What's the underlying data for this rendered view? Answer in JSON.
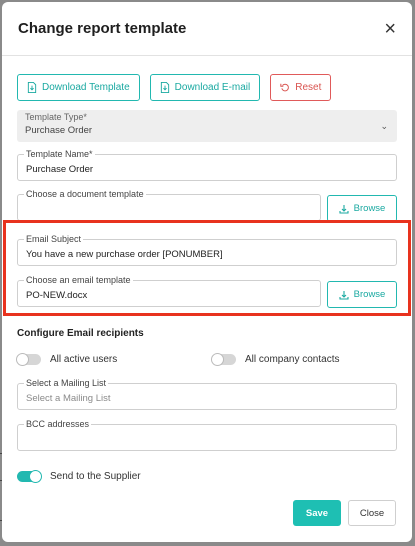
{
  "modal": {
    "title": "Change report template",
    "close_icon_glyph": "×"
  },
  "actions": {
    "download_template": "Download Template",
    "download_email": "Download E-mail",
    "reset": "Reset"
  },
  "template_type": {
    "label": "Template Type*",
    "value": "Purchase Order"
  },
  "template_name": {
    "label": "Template Name*",
    "value": "Purchase Order"
  },
  "document_template": {
    "label": "Choose a document template",
    "value": "",
    "browse": "Browse"
  },
  "email_subject": {
    "label": "Email Subject",
    "value": "You have a new purchase order [PONUMBER]"
  },
  "email_template": {
    "label": "Choose an email template",
    "value": "PO-NEW.docx",
    "browse": "Browse"
  },
  "recipients": {
    "title": "Configure Email recipients",
    "all_active_users": {
      "label": "All active users",
      "on": false
    },
    "all_company_contacts": {
      "label": "All company contacts",
      "on": false
    },
    "mailing_list": {
      "label": "Select a Mailing List",
      "placeholder": "Select a Mailing List"
    },
    "bcc": {
      "label": "BCC addresses",
      "value": ""
    },
    "send_to_supplier": {
      "label": "Send to the Supplier",
      "on": true
    }
  },
  "footer": {
    "save": "Save",
    "close": "Close"
  },
  "colors": {
    "accent": "#1ebfb3",
    "danger": "#e05a5a",
    "highlight": "#e8321e"
  }
}
